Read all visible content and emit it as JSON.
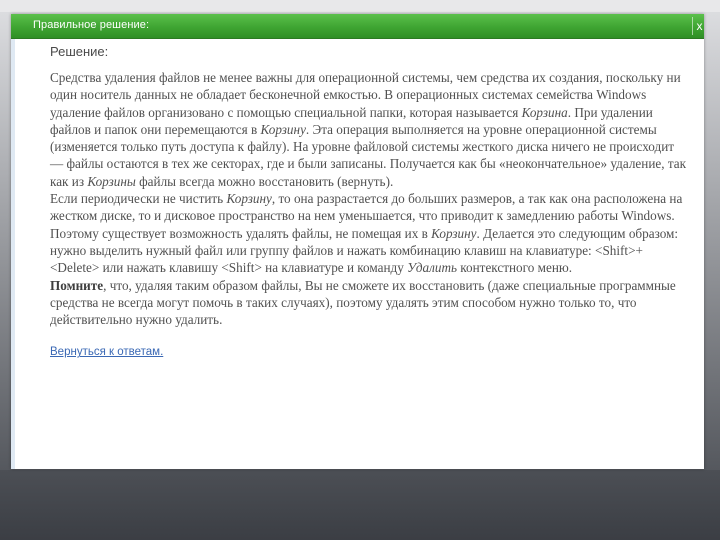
{
  "window": {
    "title": "Правильное решение:",
    "close_label": "x"
  },
  "content": {
    "heading": "Решение:",
    "paragraphs": [
      [
        {
          "t": "Средства удаления файлов не менее важны для операционной системы, чем средства их создания, поскольку ни один носитель данных не обладает бесконечной емкостью. В операционных системах семейства Windows удаление файлов организовано с помощью специальной папки, которая называется "
        },
        {
          "t": "Корзина",
          "i": true
        },
        {
          "t": ". При удалении файлов и папок они перемещаются в "
        },
        {
          "t": "Корзину",
          "i": true
        },
        {
          "t": ". Эта операция выполняется на уровне операционной системы (изменяется только путь доступа к файлу). На уровне файловой системы жесткого диска ничего не происходит — файлы остаются в тех же секторах, где и были записаны. Получается как бы «неокончательное» удаление, так как из "
        },
        {
          "t": "Корзины",
          "i": true
        },
        {
          "t": " файлы всегда можно восстановить (вернуть)."
        }
      ],
      [
        {
          "t": "Если периодически не чистить "
        },
        {
          "t": "Корзину",
          "i": true
        },
        {
          "t": ", то она разрастается до больших размеров, а так как она расположена на жестком диске, то и дисковое пространство на нем уменьшается, что приводит к замедлению работы Windows."
        }
      ],
      [
        {
          "t": "Поэтому существует возможность удалять файлы, не помещая их в "
        },
        {
          "t": "Корзину",
          "i": true
        },
        {
          "t": ". Делается это следующим образом: нужно выделить нужный файл или группу файлов и нажать комбинацию клавиш на клавиатуре: <Shift>+<Delete> или нажать клавишу <Shift> на клавиатуре и команду "
        },
        {
          "t": "Удалить",
          "i": true
        },
        {
          "t": " контекстного меню."
        }
      ],
      [
        {
          "t": "Помните",
          "b": true
        },
        {
          "t": ", что, удаляя таким образом файлы,  Вы не сможете их  восстановить (даже специальные программные средства не всегда могут помочь в таких случаях), поэтому удалять этим способом нужно только то, что действительно нужно удалить."
        }
      ]
    ],
    "back_link": "Вернуться к ответам."
  }
}
